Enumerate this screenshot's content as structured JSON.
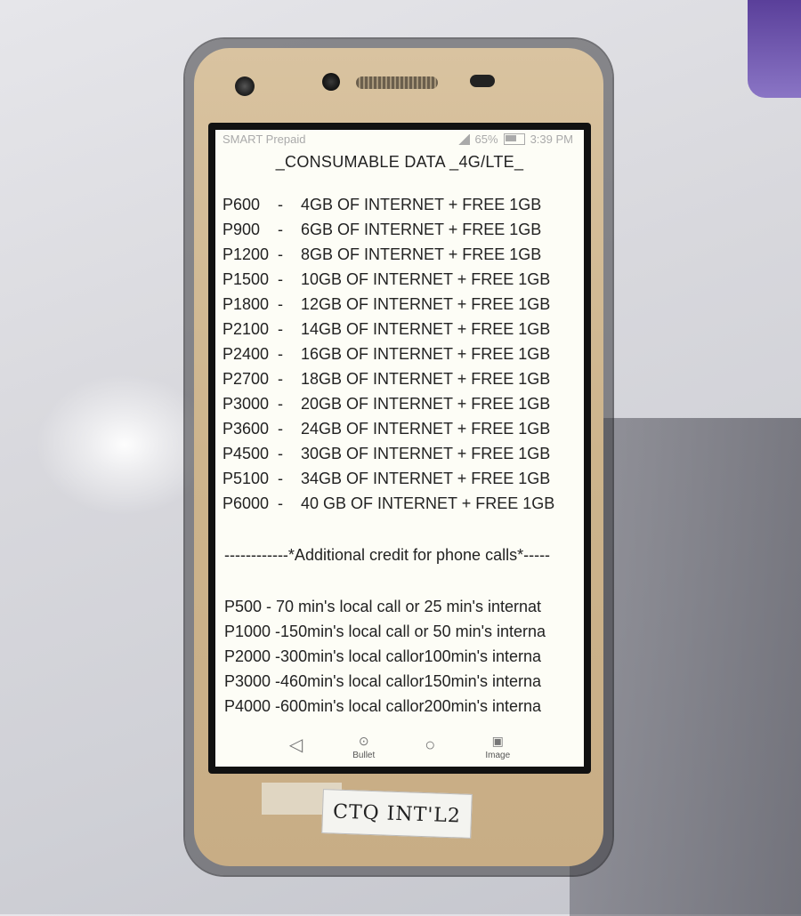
{
  "status_bar": {
    "carrier": "SMART Prepaid",
    "battery": "65%",
    "time": "3:39 PM"
  },
  "document": {
    "title": "_CONSUMABLE DATA _4G/LTE_",
    "plans": [
      {
        "price": "P600",
        "dash": "-",
        "desc": "4GB OF INTERNET + FREE 1GB"
      },
      {
        "price": "P900",
        "dash": "-",
        "desc": "6GB OF INTERNET + FREE 1GB"
      },
      {
        "price": "P1200",
        "dash": "-",
        "desc": "8GB OF INTERNET + FREE 1GB"
      },
      {
        "price": "P1500",
        "dash": "-",
        "desc": "10GB OF INTERNET + FREE 1GB"
      },
      {
        "price": "P1800",
        "dash": "-",
        "desc": "12GB OF INTERNET + FREE 1GB"
      },
      {
        "price": "P2100",
        "dash": "-",
        "desc": "14GB OF INTERNET + FREE 1GB"
      },
      {
        "price": "P2400",
        "dash": "-",
        "desc": "16GB OF INTERNET + FREE 1GB"
      },
      {
        "price": "P2700",
        "dash": "-",
        "desc": "18GB OF INTERNET + FREE 1GB"
      },
      {
        "price": "P3000",
        "dash": "-",
        "desc": "20GB OF INTERNET + FREE 1GB"
      },
      {
        "price": "P3600",
        "dash": "-",
        "desc": "24GB OF INTERNET + FREE 1GB"
      },
      {
        "price": "P4500",
        "dash": "-",
        "desc": "30GB OF INTERNET + FREE 1GB"
      },
      {
        "price": "P5100",
        "dash": "-",
        "desc": "34GB OF INTERNET + FREE 1GB"
      },
      {
        "price": "P6000",
        "dash": "-",
        "desc": "40 GB OF INTERNET + FREE 1GB"
      }
    ],
    "divider": "------------*Additional credit for phone calls*-----",
    "calls": [
      "P500 - 70 min's local call or 25 min's internat",
      "P1000 -150min's local call or 50 min's interna",
      "P2000 -300min's local callor100min's interna",
      "P3000 -460min's local callor150min's interna",
      "P4000 -600min's local callor200min's interna"
    ]
  },
  "nav": {
    "back_icon": "back-triangle-icon",
    "bullet_label": "Bullet",
    "home_icon": "home-circle-icon",
    "image_label": "Image"
  },
  "sticker_text": "CTQ INT'L2"
}
